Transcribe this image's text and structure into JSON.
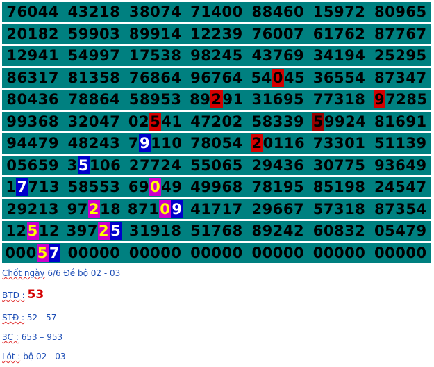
{
  "colors": {
    "background": "#008080",
    "red": "#d40000",
    "dark_red": "#990000",
    "blue": "#0000cc",
    "magenta": "#cc00cc",
    "yellow": "#ffff00",
    "white": "#ffffff",
    "note_text": "#1f4fb6"
  },
  "rows": [
    [
      {
        "digits": [
          "7",
          "6",
          "0",
          "4",
          "4"
        ]
      },
      {
        "digits": [
          "4",
          "3",
          "2",
          "1",
          "8"
        ]
      },
      {
        "digits": [
          "3",
          "8",
          "0",
          "7",
          "4"
        ]
      },
      {
        "digits": [
          "7",
          "1",
          "4",
          "0",
          "0"
        ]
      },
      {
        "digits": [
          "8",
          "8",
          "4",
          "6",
          "0"
        ]
      },
      {
        "digits": [
          "1",
          "5",
          "9",
          "7",
          "2"
        ]
      },
      {
        "digits": [
          "8",
          "0",
          "9",
          "6",
          "5"
        ]
      }
    ],
    [
      {
        "digits": [
          "2",
          "0",
          "1",
          "8",
          "2"
        ]
      },
      {
        "digits": [
          "5",
          "9",
          "9",
          "0",
          "3"
        ]
      },
      {
        "digits": [
          "8",
          "9",
          "9",
          "1",
          "4"
        ]
      },
      {
        "digits": [
          "1",
          "2",
          "2",
          "3",
          "9"
        ]
      },
      {
        "digits": [
          "7",
          "6",
          "0",
          "0",
          "7"
        ]
      },
      {
        "digits": [
          "6",
          "1",
          "7",
          "6",
          "2"
        ]
      },
      {
        "digits": [
          "8",
          "7",
          "7",
          "6",
          "7"
        ]
      }
    ],
    [
      {
        "digits": [
          "1",
          "2",
          "9",
          "4",
          "1"
        ]
      },
      {
        "digits": [
          "5",
          "4",
          "9",
          "9",
          "7"
        ]
      },
      {
        "digits": [
          "1",
          "7",
          "5",
          "3",
          "8"
        ]
      },
      {
        "digits": [
          "9",
          "8",
          "2",
          "4",
          "5"
        ]
      },
      {
        "digits": [
          "4",
          "3",
          "7",
          "6",
          "9"
        ]
      },
      {
        "digits": [
          "3",
          "4",
          "1",
          "9",
          "4"
        ]
      },
      {
        "digits": [
          "2",
          "5",
          "2",
          "9",
          "5"
        ]
      }
    ],
    [
      {
        "digits": [
          "8",
          "6",
          "3",
          "1",
          "7"
        ]
      },
      {
        "digits": [
          "8",
          "1",
          "3",
          "5",
          "8"
        ]
      },
      {
        "digits": [
          "7",
          "6",
          "8",
          "6",
          "4"
        ]
      },
      {
        "digits": [
          "9",
          "6",
          "7",
          "6",
          "4"
        ]
      },
      {
        "digits": [
          "5",
          "4",
          "0",
          "4",
          "5"
        ],
        "marks": {
          "2": "red"
        }
      },
      {
        "digits": [
          "3",
          "6",
          "5",
          "5",
          "4"
        ]
      },
      {
        "digits": [
          "8",
          "7",
          "3",
          "4",
          "7"
        ]
      }
    ],
    [
      {
        "digits": [
          "8",
          "0",
          "4",
          "3",
          "6"
        ]
      },
      {
        "digits": [
          "7",
          "8",
          "8",
          "6",
          "4"
        ]
      },
      {
        "digits": [
          "5",
          "8",
          "9",
          "5",
          "3"
        ]
      },
      {
        "digits": [
          "8",
          "9",
          "2",
          "9",
          "1"
        ],
        "marks": {
          "2": "red"
        }
      },
      {
        "digits": [
          "3",
          "1",
          "6",
          "9",
          "5"
        ]
      },
      {
        "digits": [
          "7",
          "7",
          "3",
          "1",
          "8"
        ]
      },
      {
        "digits": [
          "9",
          "7",
          "2",
          "8",
          "5"
        ],
        "marks": {
          "0": "red"
        }
      }
    ],
    [
      {
        "digits": [
          "9",
          "9",
          "3",
          "6",
          "8"
        ]
      },
      {
        "digits": [
          "3",
          "2",
          "0",
          "4",
          "7"
        ]
      },
      {
        "digits": [
          "0",
          "2",
          "5",
          "4",
          "1"
        ],
        "marks": {
          "2": "red"
        }
      },
      {
        "digits": [
          "4",
          "7",
          "2",
          "0",
          "2"
        ]
      },
      {
        "digits": [
          "5",
          "8",
          "3",
          "3",
          "9"
        ]
      },
      {
        "digits": [
          "5",
          "9",
          "9",
          "2",
          "4"
        ],
        "marks": {
          "0": "dark_red"
        }
      },
      {
        "digits": [
          "8",
          "1",
          "6",
          "9",
          "1"
        ]
      }
    ],
    [
      {
        "digits": [
          "9",
          "4",
          "4",
          "7",
          "9"
        ]
      },
      {
        "digits": [
          "4",
          "8",
          "2",
          "4",
          "3"
        ]
      },
      {
        "digits": [
          "7",
          "9",
          "1",
          "1",
          "0"
        ],
        "marks": {
          "1": "blue"
        }
      },
      {
        "digits": [
          "7",
          "8",
          "0",
          "5",
          "4"
        ]
      },
      {
        "digits": [
          "2",
          "0",
          "1",
          "1",
          "6"
        ],
        "marks": {
          "0": "red"
        }
      },
      {
        "digits": [
          "7",
          "3",
          "3",
          "0",
          "1"
        ]
      },
      {
        "digits": [
          "5",
          "1",
          "1",
          "3",
          "9"
        ]
      }
    ],
    [
      {
        "digits": [
          "0",
          "5",
          "6",
          "5",
          "9"
        ]
      },
      {
        "digits": [
          "3",
          "5",
          "1",
          "0",
          "6"
        ],
        "marks": {
          "1": "blue"
        }
      },
      {
        "digits": [
          "2",
          "7",
          "7",
          "2",
          "4"
        ]
      },
      {
        "digits": [
          "5",
          "5",
          "0",
          "6",
          "5"
        ]
      },
      {
        "digits": [
          "2",
          "9",
          "4",
          "3",
          "6"
        ]
      },
      {
        "digits": [
          "3",
          "0",
          "7",
          "7",
          "5"
        ]
      },
      {
        "digits": [
          "9",
          "3",
          "6",
          "4",
          "9"
        ]
      }
    ],
    [
      {
        "digits": [
          "1",
          "7",
          "7",
          "1",
          "3"
        ],
        "marks": {
          "1": "blue"
        }
      },
      {
        "digits": [
          "5",
          "8",
          "5",
          "5",
          "3"
        ]
      },
      {
        "digits": [
          "6",
          "9",
          "0",
          "4",
          "9"
        ],
        "marks": {
          "2": "magenta"
        }
      },
      {
        "digits": [
          "4",
          "9",
          "9",
          "6",
          "8"
        ]
      },
      {
        "digits": [
          "7",
          "8",
          "1",
          "9",
          "5"
        ]
      },
      {
        "digits": [
          "8",
          "5",
          "1",
          "9",
          "8"
        ]
      },
      {
        "digits": [
          "2",
          "4",
          "5",
          "4",
          "7"
        ]
      }
    ],
    [
      {
        "digits": [
          "2",
          "9",
          "2",
          "1",
          "3"
        ]
      },
      {
        "digits": [
          "9",
          "7",
          "2",
          "1",
          "8"
        ],
        "marks": {
          "2": "magenta"
        }
      },
      {
        "digits": [
          "8",
          "7",
          "1",
          "0",
          "9"
        ],
        "marks": {
          "3": "magenta",
          "4": "blue"
        }
      },
      {
        "digits": [
          "4",
          "1",
          "7",
          "1",
          "7"
        ]
      },
      {
        "digits": [
          "2",
          "9",
          "6",
          "6",
          "7"
        ]
      },
      {
        "digits": [
          "5",
          "7",
          "3",
          "1",
          "8"
        ]
      },
      {
        "digits": [
          "8",
          "7",
          "3",
          "5",
          "4"
        ]
      }
    ],
    [
      {
        "digits": [
          "1",
          "2",
          "5",
          "1",
          "2"
        ],
        "marks": {
          "2": "magenta"
        }
      },
      {
        "digits": [
          "3",
          "9",
          "7",
          "2",
          "5"
        ],
        "marks": {
          "3": "magenta",
          "4": "blue"
        }
      },
      {
        "digits": [
          "3",
          "1",
          "9",
          "1",
          "8"
        ]
      },
      {
        "digits": [
          "5",
          "1",
          "7",
          "6",
          "8"
        ]
      },
      {
        "digits": [
          "8",
          "9",
          "2",
          "4",
          "2"
        ]
      },
      {
        "digits": [
          "6",
          "0",
          "8",
          "3",
          "2"
        ]
      },
      {
        "digits": [
          "0",
          "5",
          "4",
          "7",
          "9"
        ]
      }
    ],
    [
      {
        "digits": [
          "0",
          "0",
          "0",
          "5",
          "7"
        ],
        "marks": {
          "3": "magenta",
          "4": "blue"
        }
      },
      {
        "digits": [
          "0",
          "0",
          "0",
          "0",
          "0"
        ]
      },
      {
        "digits": [
          "0",
          "0",
          "0",
          "0",
          "0"
        ]
      },
      {
        "digits": [
          "0",
          "0",
          "0",
          "0",
          "0"
        ]
      },
      {
        "digits": [
          "0",
          "0",
          "0",
          "0",
          "0"
        ]
      },
      {
        "digits": [
          "0",
          "0",
          "0",
          "0",
          "0"
        ]
      },
      {
        "digits": [
          "0",
          "0",
          "0",
          "0",
          "0"
        ]
      }
    ]
  ],
  "notes": {
    "chot_label": "Chốt ngày",
    "chot_text": " 6/6 Đề bộ 02 - 03",
    "btd_label": "BTĐ :",
    "btd_value": "53",
    "std_label": "STĐ :",
    "std_value": " 52 - 57",
    "three_c_label": "3C :",
    "three_c_value": " 653 – 953",
    "lot_label": "Lót :",
    "lot_value": " bộ 02 - 03"
  }
}
